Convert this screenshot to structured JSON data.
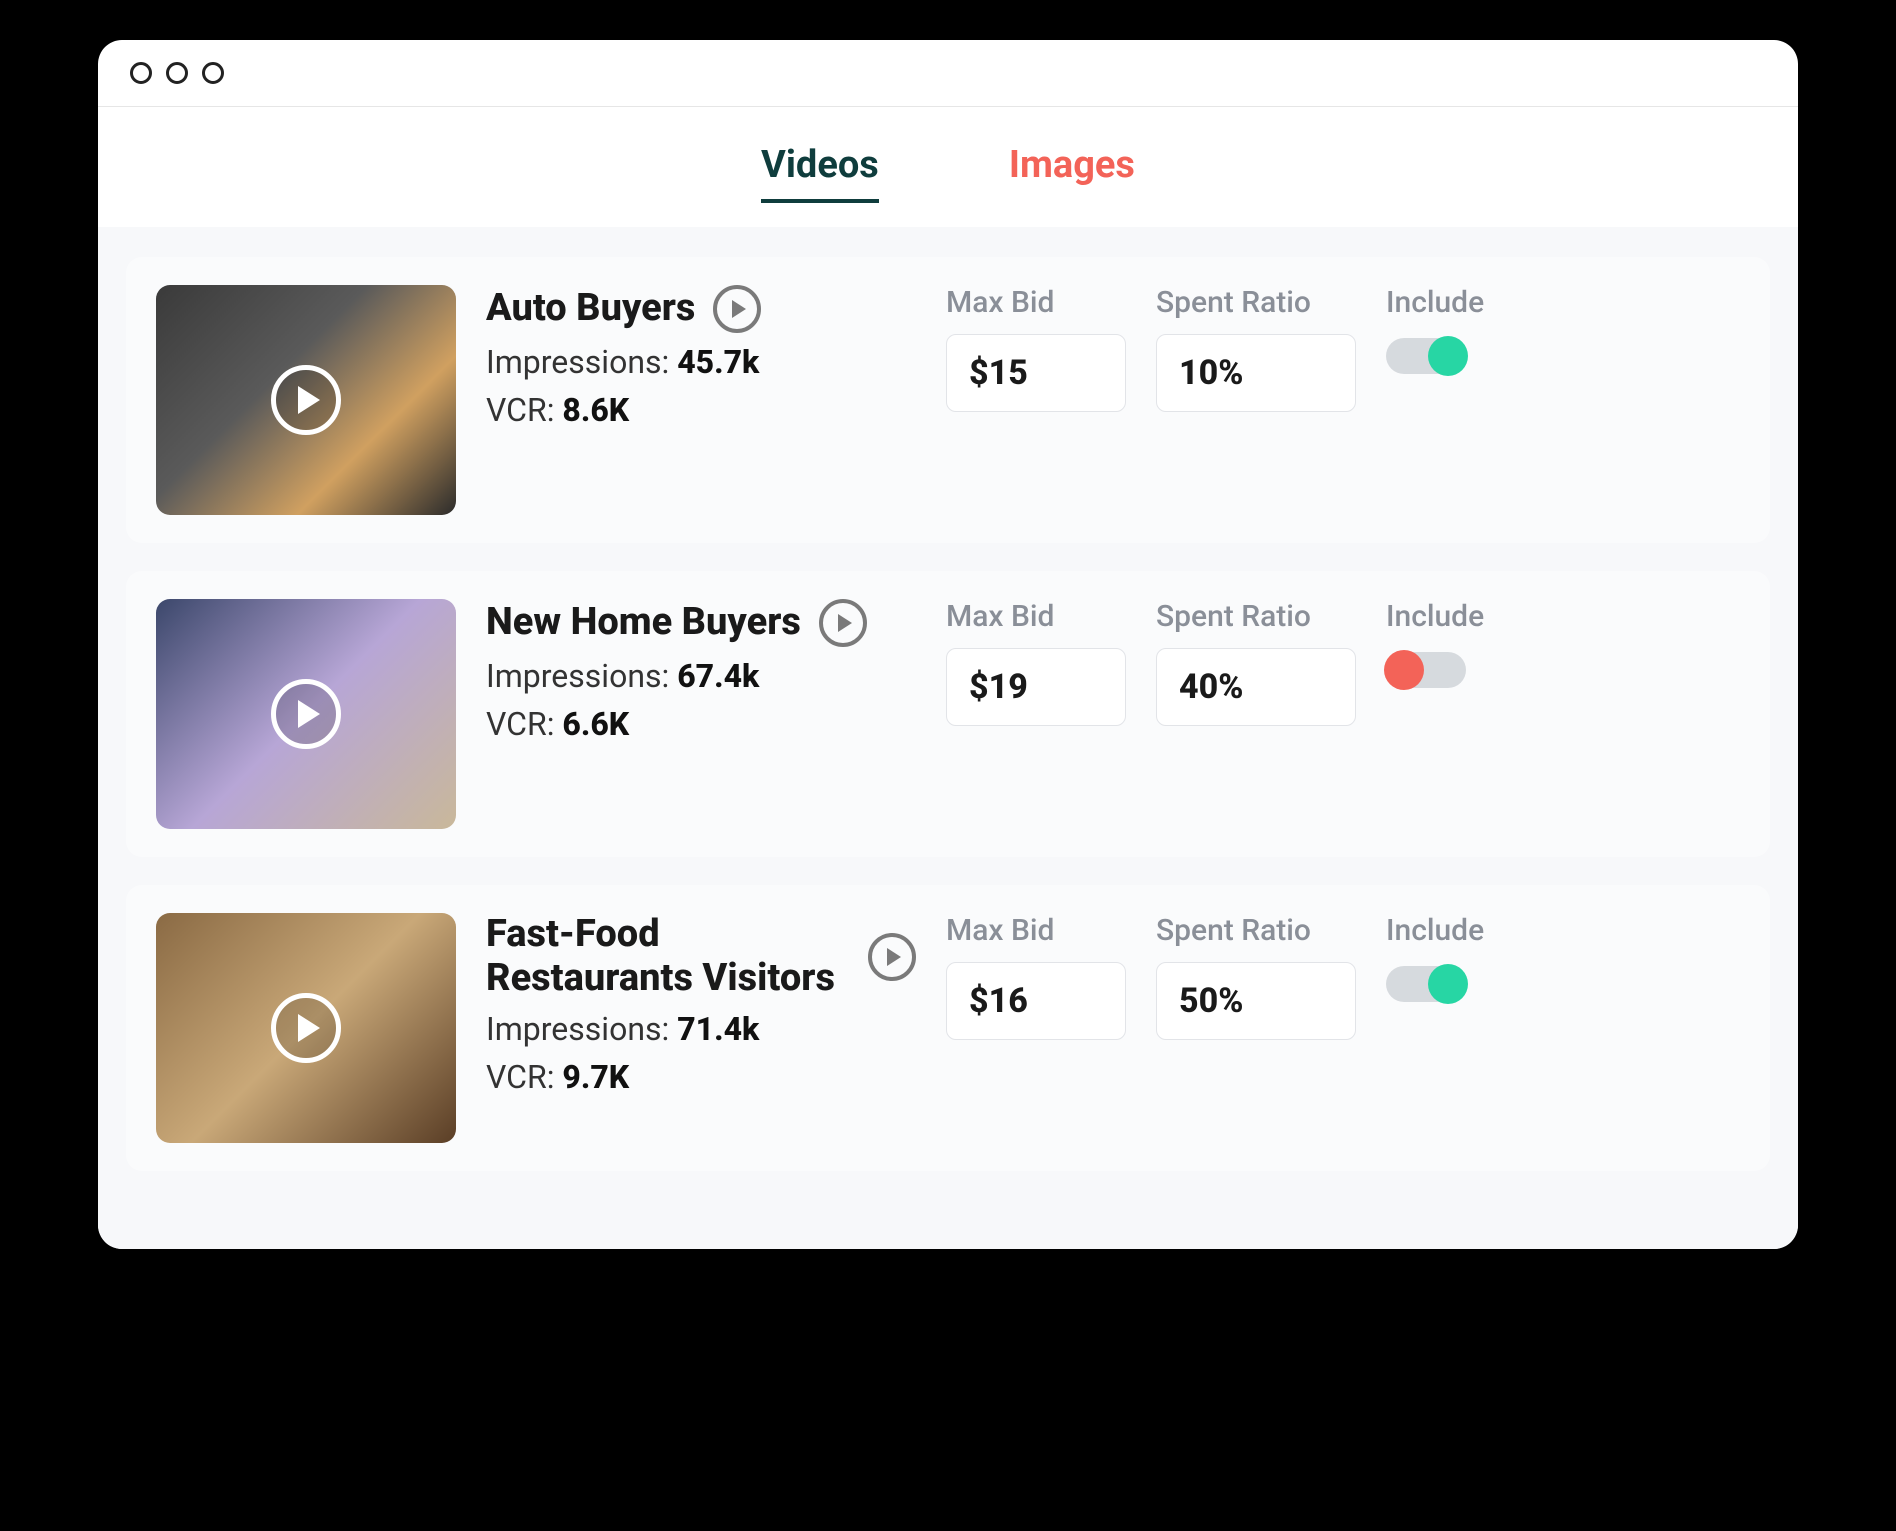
{
  "tabs": {
    "videos": "Videos",
    "images": "Images",
    "active": "videos"
  },
  "labels": {
    "max_bid": "Max Bid",
    "spent_ratio": "Spent Ratio",
    "include": "Include",
    "impressions_prefix": "Impressions: ",
    "vcr_prefix": "VCR: "
  },
  "rows": [
    {
      "title": "Auto Buyers",
      "impressions": "45.7k",
      "vcr": "8.6K",
      "max_bid": "$15",
      "spent_ratio": "10%",
      "include": true,
      "thumb_class": "bg1"
    },
    {
      "title": "New Home Buyers",
      "impressions": "67.4k",
      "vcr": "6.6K",
      "max_bid": "$19",
      "spent_ratio": "40%",
      "include": false,
      "thumb_class": "bg2"
    },
    {
      "title": "Fast-Food Restaurants Visitors",
      "impressions": "71.4k",
      "vcr": "9.7K",
      "max_bid": "$16",
      "spent_ratio": "50%",
      "include": true,
      "thumb_class": "bg3"
    }
  ]
}
